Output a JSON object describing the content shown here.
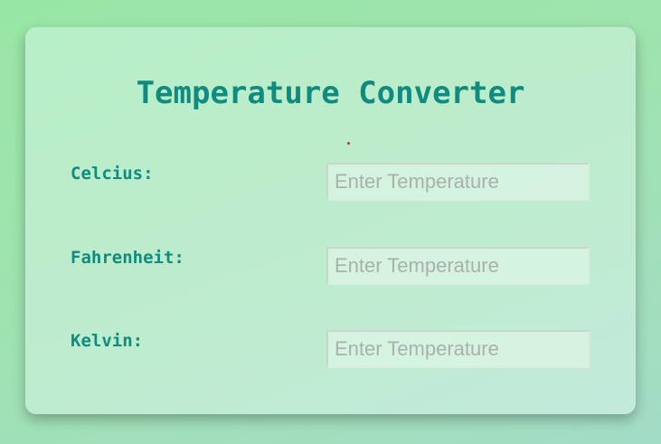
{
  "title": "Temperature Converter",
  "fields": [
    {
      "label": "Celcius:",
      "placeholder": "Enter Temperature",
      "value": ""
    },
    {
      "label": "Fahrenheit:",
      "placeholder": "Enter Temperature",
      "value": ""
    },
    {
      "label": "Kelvin:",
      "placeholder": "Enter Temperature",
      "value": ""
    }
  ],
  "colors": {
    "accent": "#0f8b80",
    "background": "#98e6a6",
    "card": "#bdeccc",
    "dot": "#c0392b"
  }
}
